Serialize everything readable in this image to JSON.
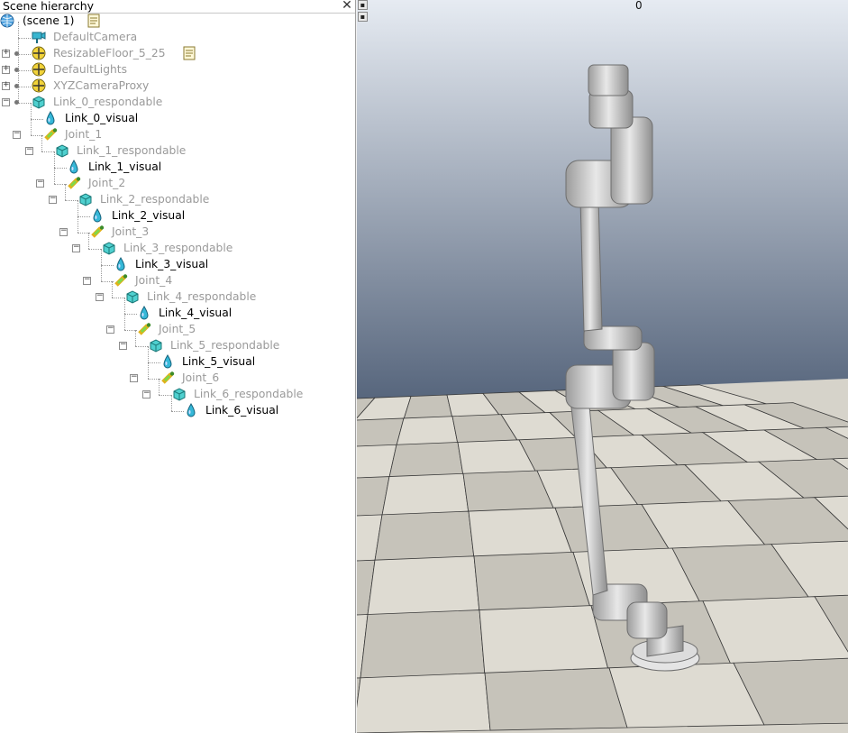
{
  "panel": {
    "title": "Scene hierarchy",
    "close_glyph": "✕"
  },
  "viewport": {
    "frame_counter": "0",
    "scroll_up_glyph": "▪",
    "scroll_down_glyph": "▪"
  },
  "tree": [
    {
      "label": "(scene 1)",
      "icon": "scene-globe-icon",
      "style": "bright",
      "extra": "script-icon",
      "expand": ""
    },
    {
      "label": "DefaultCamera",
      "icon": "camera-icon",
      "style": "dim",
      "expand": ""
    },
    {
      "label": "ResizableFloor_5_25",
      "icon": "dummy-model-icon",
      "style": "dim",
      "expand": "+",
      "extra": "script-icon"
    },
    {
      "label": "DefaultLights",
      "icon": "dummy-model-icon",
      "style": "dim",
      "expand": "+"
    },
    {
      "label": "XYZCameraProxy",
      "icon": "dummy-model-icon",
      "style": "dim",
      "expand": "+"
    },
    {
      "label": "Link_0_respondable",
      "icon": "cuboid-icon",
      "style": "dim",
      "expand": "−"
    },
    {
      "label": "Link_0_visual",
      "icon": "shape-drop-icon",
      "style": "bright",
      "expand": ""
    },
    {
      "label": "Joint_1",
      "icon": "joint-icon",
      "style": "dim",
      "expand": "−"
    },
    {
      "label": "Link_1_respondable",
      "icon": "cuboid-icon",
      "style": "dim",
      "expand": "−"
    },
    {
      "label": "Link_1_visual",
      "icon": "shape-drop-icon",
      "style": "bright",
      "expand": ""
    },
    {
      "label": "Joint_2",
      "icon": "joint-icon",
      "style": "dim",
      "expand": "−"
    },
    {
      "label": "Link_2_respondable",
      "icon": "cuboid-icon",
      "style": "dim",
      "expand": "−"
    },
    {
      "label": "Link_2_visual",
      "icon": "shape-drop-icon",
      "style": "bright",
      "expand": ""
    },
    {
      "label": "Joint_3",
      "icon": "joint-icon",
      "style": "dim",
      "expand": "−"
    },
    {
      "label": "Link_3_respondable",
      "icon": "cuboid-icon",
      "style": "dim",
      "expand": "−"
    },
    {
      "label": "Link_3_visual",
      "icon": "shape-drop-icon",
      "style": "bright",
      "expand": ""
    },
    {
      "label": "Joint_4",
      "icon": "joint-icon",
      "style": "dim",
      "expand": "−"
    },
    {
      "label": "Link_4_respondable",
      "icon": "cuboid-icon",
      "style": "dim",
      "expand": "−"
    },
    {
      "label": "Link_4_visual",
      "icon": "shape-drop-icon",
      "style": "bright",
      "expand": ""
    },
    {
      "label": "Joint_5",
      "icon": "joint-icon",
      "style": "dim",
      "expand": "−"
    },
    {
      "label": "Link_5_respondable",
      "icon": "cuboid-icon",
      "style": "dim",
      "expand": "−"
    },
    {
      "label": "Link_5_visual",
      "icon": "shape-drop-icon",
      "style": "bright",
      "expand": ""
    },
    {
      "label": "Joint_6",
      "icon": "joint-icon",
      "style": "dim",
      "expand": "−"
    },
    {
      "label": "Link_6_respondable",
      "icon": "cuboid-icon",
      "style": "dim",
      "expand": "−"
    },
    {
      "label": "Link_6_visual",
      "icon": "shape-drop-icon",
      "style": "bright",
      "expand": ""
    }
  ],
  "colors": {
    "sky_top": "#e6ebf2",
    "sky_bottom": "#56657c",
    "floor_light": "#dedbd2",
    "floor_dark": "#c6c3ba",
    "robot": "#d4d4d4"
  }
}
